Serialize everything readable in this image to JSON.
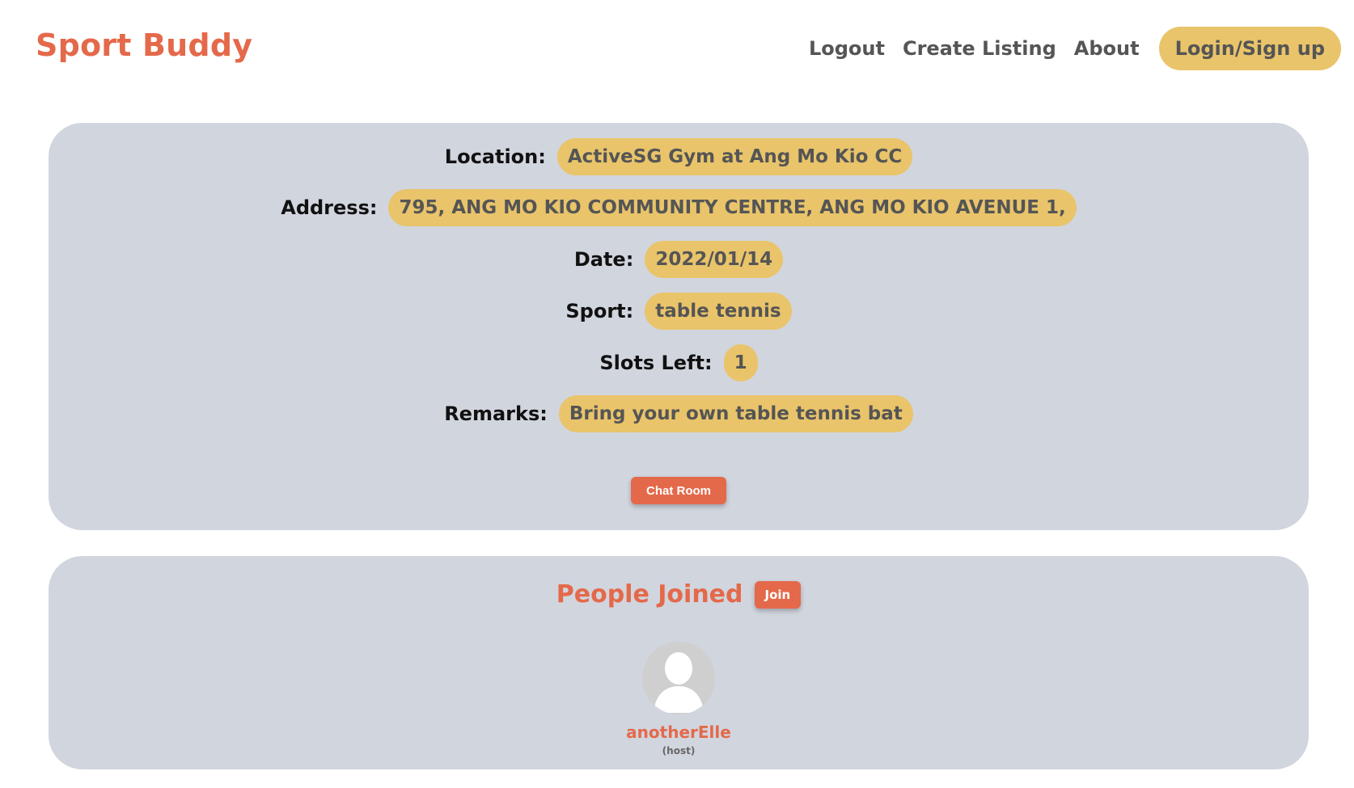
{
  "brand": {
    "name": "Sport Buddy"
  },
  "nav": {
    "logout": "Logout",
    "create_listing": "Create Listing",
    "about": "About",
    "login_signup": "Login/Sign up"
  },
  "listing": {
    "location": {
      "label": "Location:",
      "value": "ActiveSG Gym at Ang Mo Kio CC"
    },
    "address": {
      "label": "Address:",
      "value": "795, ANG MO KIO COMMUNITY CENTRE, ANG MO KIO AVENUE 1,"
    },
    "date": {
      "label": "Date:",
      "value": "2022/01/14"
    },
    "sport": {
      "label": "Sport:",
      "value": "table tennis"
    },
    "slots": {
      "label": "Slots Left:",
      "value": "1"
    },
    "remarks": {
      "label": "Remarks:",
      "value": "Bring your own table tennis bat"
    },
    "chat_button": "Chat Room"
  },
  "people": {
    "title": "People Joined",
    "join_button": "Join",
    "members": [
      {
        "name": "anotherElle",
        "role": "(host)"
      }
    ]
  },
  "colors": {
    "brand": "#e4694a",
    "pill": "#e9c46a",
    "card": "#d1d5de"
  },
  "icons": {
    "avatar": "default-user-avatar-icon"
  }
}
